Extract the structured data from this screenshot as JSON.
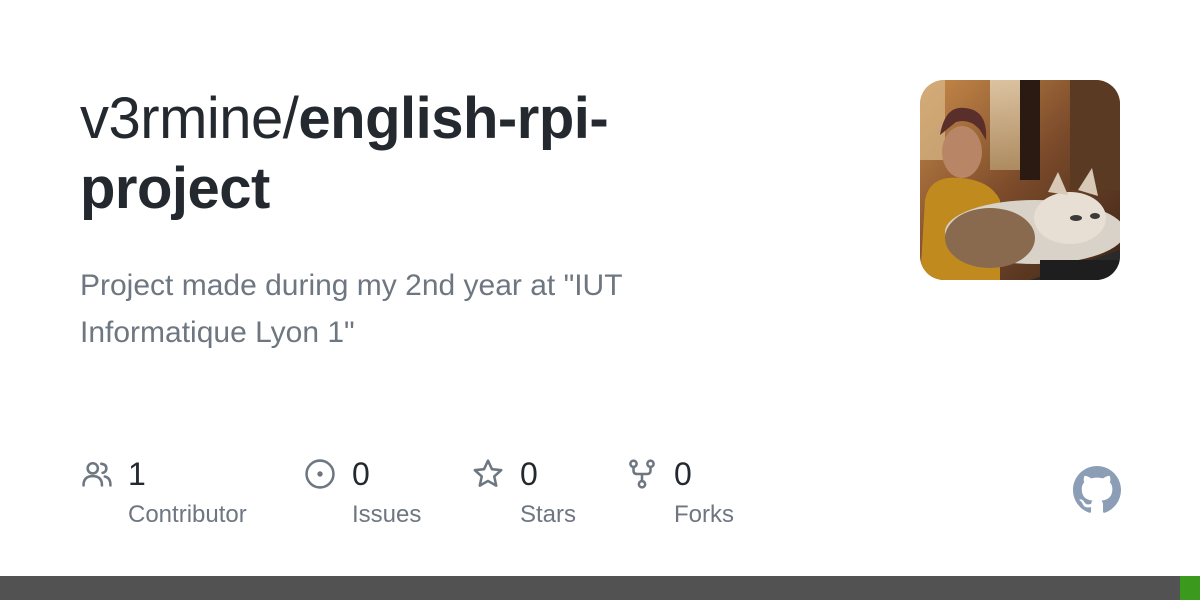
{
  "repo": {
    "owner": "v3rmine/",
    "name": "english-rpi-project",
    "name_line1": "english-rpi-",
    "name_line2": "project",
    "description": "Project made during my 2nd year at \"IUT Informatique Lyon 1\""
  },
  "stats": [
    {
      "icon": "people-icon",
      "count": "1",
      "label": "Contributor"
    },
    {
      "icon": "issue-icon",
      "count": "0",
      "label": "Issues"
    },
    {
      "icon": "star-icon",
      "count": "0",
      "label": "Stars"
    },
    {
      "icon": "fork-icon",
      "count": "0",
      "label": "Forks"
    }
  ],
  "colors": {
    "text_primary": "#24292f",
    "text_secondary": "#6e7781",
    "icon": "#6e7781",
    "github_logo": "#8b9eb5",
    "bottom_bar": "#525252",
    "language_accent": "#3b9a1e"
  },
  "icons": {
    "avatar": "avatar-photo",
    "logo": "github-mark-icon"
  }
}
